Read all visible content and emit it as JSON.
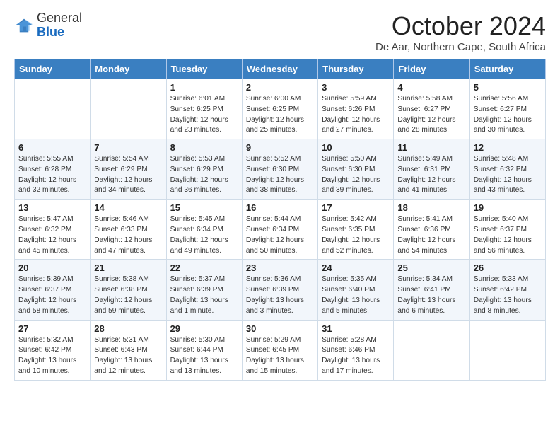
{
  "logo": {
    "general": "General",
    "blue": "Blue"
  },
  "title": "October 2024",
  "subtitle": "De Aar, Northern Cape, South Africa",
  "days_of_week": [
    "Sunday",
    "Monday",
    "Tuesday",
    "Wednesday",
    "Thursday",
    "Friday",
    "Saturday"
  ],
  "weeks": [
    [
      {
        "day": "",
        "content": ""
      },
      {
        "day": "",
        "content": ""
      },
      {
        "day": "1",
        "content": "Sunrise: 6:01 AM\nSunset: 6:25 PM\nDaylight: 12 hours and 23 minutes."
      },
      {
        "day": "2",
        "content": "Sunrise: 6:00 AM\nSunset: 6:25 PM\nDaylight: 12 hours and 25 minutes."
      },
      {
        "day": "3",
        "content": "Sunrise: 5:59 AM\nSunset: 6:26 PM\nDaylight: 12 hours and 27 minutes."
      },
      {
        "day": "4",
        "content": "Sunrise: 5:58 AM\nSunset: 6:27 PM\nDaylight: 12 hours and 28 minutes."
      },
      {
        "day": "5",
        "content": "Sunrise: 5:56 AM\nSunset: 6:27 PM\nDaylight: 12 hours and 30 minutes."
      }
    ],
    [
      {
        "day": "6",
        "content": "Sunrise: 5:55 AM\nSunset: 6:28 PM\nDaylight: 12 hours and 32 minutes."
      },
      {
        "day": "7",
        "content": "Sunrise: 5:54 AM\nSunset: 6:29 PM\nDaylight: 12 hours and 34 minutes."
      },
      {
        "day": "8",
        "content": "Sunrise: 5:53 AM\nSunset: 6:29 PM\nDaylight: 12 hours and 36 minutes."
      },
      {
        "day": "9",
        "content": "Sunrise: 5:52 AM\nSunset: 6:30 PM\nDaylight: 12 hours and 38 minutes."
      },
      {
        "day": "10",
        "content": "Sunrise: 5:50 AM\nSunset: 6:30 PM\nDaylight: 12 hours and 39 minutes."
      },
      {
        "day": "11",
        "content": "Sunrise: 5:49 AM\nSunset: 6:31 PM\nDaylight: 12 hours and 41 minutes."
      },
      {
        "day": "12",
        "content": "Sunrise: 5:48 AM\nSunset: 6:32 PM\nDaylight: 12 hours and 43 minutes."
      }
    ],
    [
      {
        "day": "13",
        "content": "Sunrise: 5:47 AM\nSunset: 6:32 PM\nDaylight: 12 hours and 45 minutes."
      },
      {
        "day": "14",
        "content": "Sunrise: 5:46 AM\nSunset: 6:33 PM\nDaylight: 12 hours and 47 minutes."
      },
      {
        "day": "15",
        "content": "Sunrise: 5:45 AM\nSunset: 6:34 PM\nDaylight: 12 hours and 49 minutes."
      },
      {
        "day": "16",
        "content": "Sunrise: 5:44 AM\nSunset: 6:34 PM\nDaylight: 12 hours and 50 minutes."
      },
      {
        "day": "17",
        "content": "Sunrise: 5:42 AM\nSunset: 6:35 PM\nDaylight: 12 hours and 52 minutes."
      },
      {
        "day": "18",
        "content": "Sunrise: 5:41 AM\nSunset: 6:36 PM\nDaylight: 12 hours and 54 minutes."
      },
      {
        "day": "19",
        "content": "Sunrise: 5:40 AM\nSunset: 6:37 PM\nDaylight: 12 hours and 56 minutes."
      }
    ],
    [
      {
        "day": "20",
        "content": "Sunrise: 5:39 AM\nSunset: 6:37 PM\nDaylight: 12 hours and 58 minutes."
      },
      {
        "day": "21",
        "content": "Sunrise: 5:38 AM\nSunset: 6:38 PM\nDaylight: 12 hours and 59 minutes."
      },
      {
        "day": "22",
        "content": "Sunrise: 5:37 AM\nSunset: 6:39 PM\nDaylight: 13 hours and 1 minute."
      },
      {
        "day": "23",
        "content": "Sunrise: 5:36 AM\nSunset: 6:39 PM\nDaylight: 13 hours and 3 minutes."
      },
      {
        "day": "24",
        "content": "Sunrise: 5:35 AM\nSunset: 6:40 PM\nDaylight: 13 hours and 5 minutes."
      },
      {
        "day": "25",
        "content": "Sunrise: 5:34 AM\nSunset: 6:41 PM\nDaylight: 13 hours and 6 minutes."
      },
      {
        "day": "26",
        "content": "Sunrise: 5:33 AM\nSunset: 6:42 PM\nDaylight: 13 hours and 8 minutes."
      }
    ],
    [
      {
        "day": "27",
        "content": "Sunrise: 5:32 AM\nSunset: 6:42 PM\nDaylight: 13 hours and 10 minutes."
      },
      {
        "day": "28",
        "content": "Sunrise: 5:31 AM\nSunset: 6:43 PM\nDaylight: 13 hours and 12 minutes."
      },
      {
        "day": "29",
        "content": "Sunrise: 5:30 AM\nSunset: 6:44 PM\nDaylight: 13 hours and 13 minutes."
      },
      {
        "day": "30",
        "content": "Sunrise: 5:29 AM\nSunset: 6:45 PM\nDaylight: 13 hours and 15 minutes."
      },
      {
        "day": "31",
        "content": "Sunrise: 5:28 AM\nSunset: 6:46 PM\nDaylight: 13 hours and 17 minutes."
      },
      {
        "day": "",
        "content": ""
      },
      {
        "day": "",
        "content": ""
      }
    ]
  ]
}
